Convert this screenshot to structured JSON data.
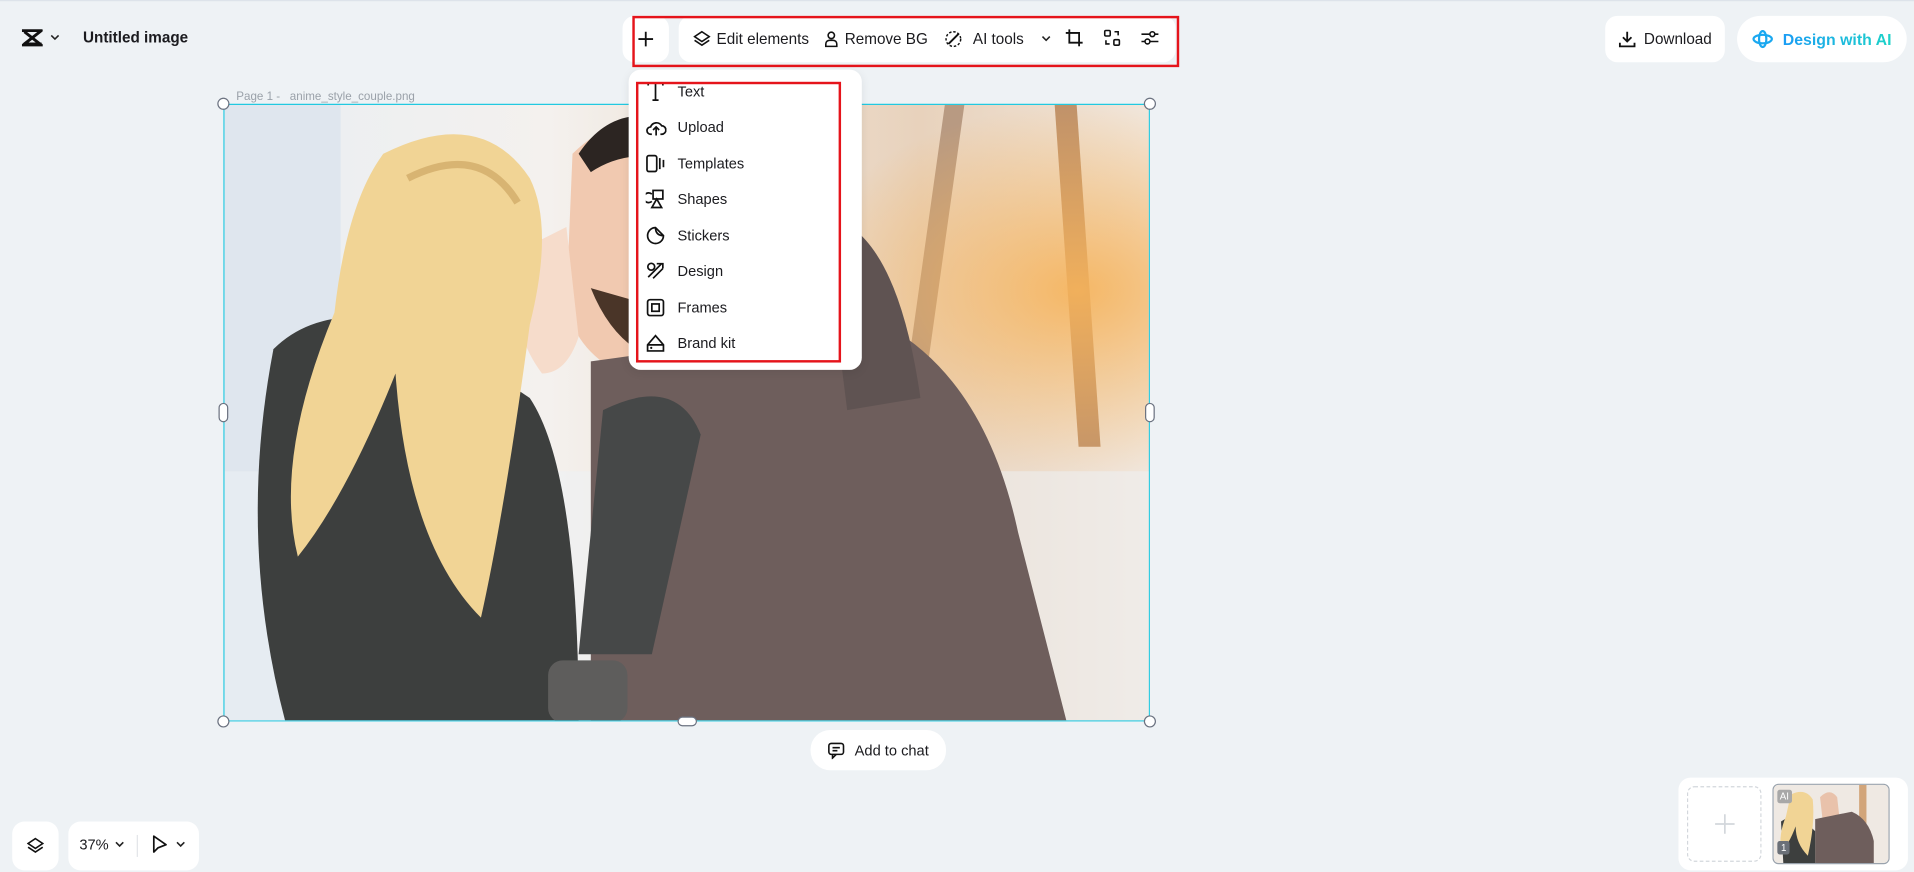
{
  "header": {
    "title": "Untitled image"
  },
  "toolbar": {
    "add_label": "+",
    "edit_elements": "Edit elements",
    "remove_bg": "Remove BG",
    "ai_tools": "AI tools"
  },
  "actions": {
    "download": "Download",
    "design_with_ai": "Design with AI"
  },
  "canvas": {
    "page_label": "Page 1 -",
    "file_name": "anime_style_couple.png",
    "add_to_chat": "Add to chat"
  },
  "add_menu": {
    "items": [
      {
        "label": "Text",
        "icon": "text-icon"
      },
      {
        "label": "Upload",
        "icon": "upload-icon"
      },
      {
        "label": "Templates",
        "icon": "templates-icon"
      },
      {
        "label": "Shapes",
        "icon": "shapes-icon"
      },
      {
        "label": "Stickers",
        "icon": "stickers-icon"
      },
      {
        "label": "Design",
        "icon": "design-icon"
      },
      {
        "label": "Frames",
        "icon": "frames-icon"
      },
      {
        "label": "Brand kit",
        "icon": "brand-kit-icon"
      }
    ]
  },
  "footer": {
    "zoom": "37%",
    "thumb_badge": "AI",
    "thumb_page": "1"
  },
  "colors": {
    "selection": "#1ec8e0",
    "highlight": "#e5141b",
    "accent_gradient_start": "#1a9cf5",
    "accent_gradient_end": "#1dd3c8"
  }
}
